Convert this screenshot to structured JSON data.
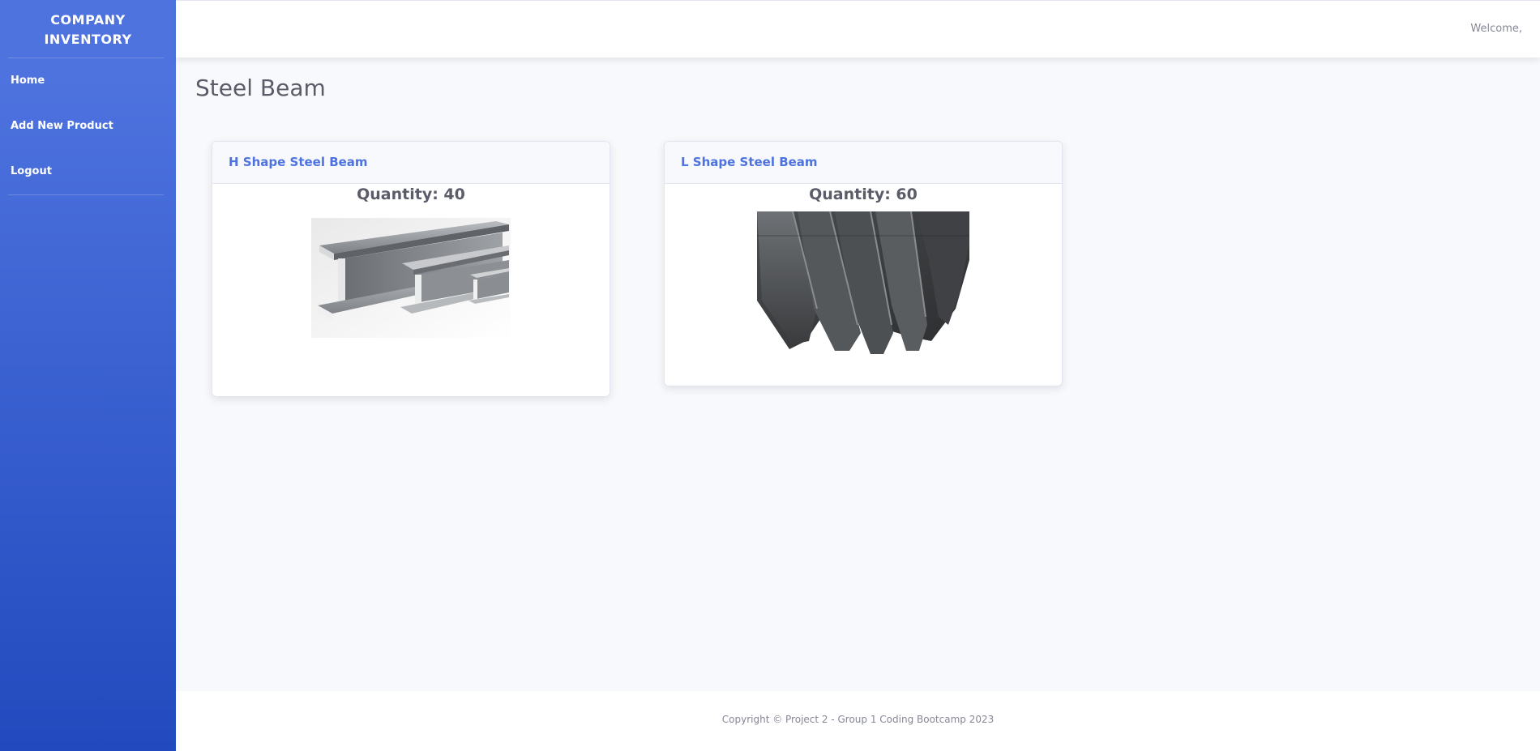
{
  "sidebar": {
    "brand_line1": "COMPANY",
    "brand_line2": "INVENTORY",
    "items": [
      {
        "label": "Home"
      },
      {
        "label": "Add New Product"
      },
      {
        "label": "Logout"
      }
    ],
    "gradient_start": "#4e73df",
    "gradient_end": "#224abe"
  },
  "topbar": {
    "welcome": "Welcome,"
  },
  "main": {
    "title": "Steel Beam",
    "products": [
      {
        "name": "H Shape Steel Beam",
        "quantity": "Quantity: 40",
        "image": "h-beam-image"
      },
      {
        "name": "L Shape Steel Beam",
        "quantity": "Quantity: 60",
        "image": "l-angle-image"
      }
    ]
  },
  "footer": {
    "copyright": "Copyright © Project 2 - Group 1 Coding Bootcamp 2023"
  },
  "colors": {
    "accent": "#4e73df",
    "text_gray": "#5a5c69",
    "muted": "#858796",
    "background": "#f8f9fc"
  }
}
